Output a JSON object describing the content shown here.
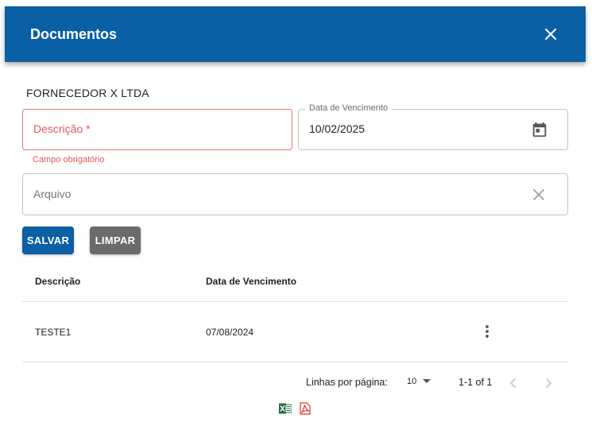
{
  "dialog": {
    "title": "Documentos",
    "close_icon": "close-icon",
    "header_color": "#0b5fa5"
  },
  "supplier": "FORNECEDOR X LTDA",
  "form": {
    "description": {
      "placeholder": "Descrição *",
      "error": "Campo obrigatório"
    },
    "due_date": {
      "label": "Data de Vencimento",
      "value": "10/02/2025",
      "icon": "calendar-icon"
    },
    "file": {
      "placeholder": "Arquivo",
      "icon": "clear-icon"
    },
    "save_label": "SALVAR",
    "clear_label": "LIMPAR"
  },
  "table": {
    "columns": [
      "Descrição",
      "Data de Vencimento"
    ],
    "rows": [
      {
        "description": "TESTE1",
        "due_date": "07/08/2024",
        "menu_icon": "more-vert-icon"
      }
    ]
  },
  "pagination": {
    "rows_per_page_label": "Linhas por página:",
    "rows_per_page": "10",
    "range": "1-1 of 1"
  },
  "exports": {
    "excel_icon": "excel-icon",
    "pdf_icon": "pdf-icon",
    "excel_color": "#1d7044",
    "pdf_color": "#e0362a"
  }
}
